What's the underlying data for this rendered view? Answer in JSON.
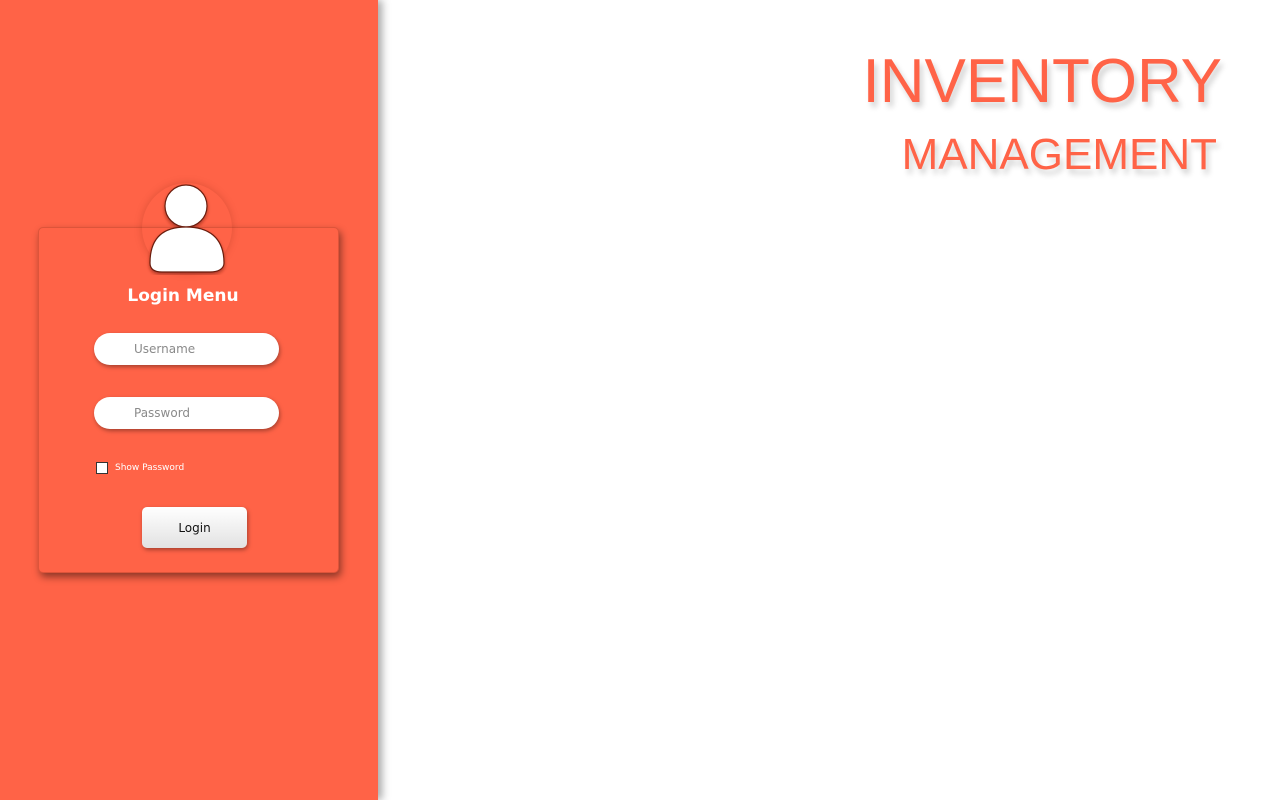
{
  "colors": {
    "accent": "#ff6347",
    "panel_text": "#ffffff",
    "button_text": "#111111"
  },
  "login": {
    "avatar_icon": "user-icon",
    "title": "Login Menu",
    "username": {
      "value": "",
      "placeholder": "Username"
    },
    "password": {
      "value": "",
      "placeholder": "Password"
    },
    "show_password": {
      "label": "Show Password",
      "checked": false
    },
    "submit_label": "Login"
  },
  "header": {
    "line1": "INVENTORY",
    "line2": "MANAGEMENT"
  }
}
